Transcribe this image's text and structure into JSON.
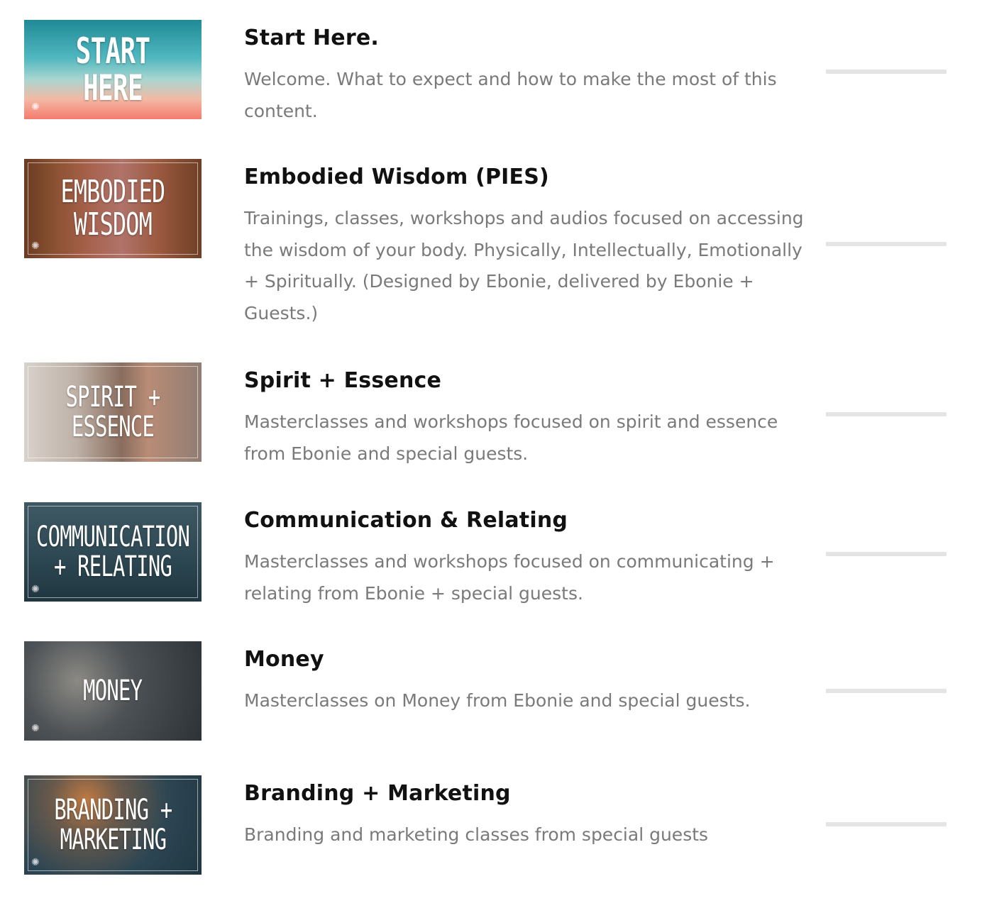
{
  "courses": [
    {
      "thumb_text": "START HERE",
      "thumb_bg": "linear-gradient(180deg,#1f8a96 0%,#4fb7bf 38%,#a9d6d0 60%,#f3b9a4 80%,#f47b6e 100%)",
      "title": "Start Here.",
      "description": "Welcome. What to expect and how to make the most of this content.",
      "progress": 0
    },
    {
      "thumb_text": "EMBODIED\nWISDOM",
      "thumb_bg": "linear-gradient(90deg,#6a3b22 0%,#8c5233 18%,#a5604a 35%,#b0736a 55%,#9c5a40 75%,#6e3f25 100%)",
      "title": "Embodied Wisdom (PIES)",
      "description": "Trainings, classes, workshops and audios focused on accessing the wisdom of your body. Physically, Intellectually, Emotionally + Spiritually. (Designed by Ebonie, delivered by Ebonie + Guests.)",
      "progress": 0
    },
    {
      "thumb_text": "SPIRIT + ESSENCE",
      "thumb_bg": "linear-gradient(90deg,#d9d2cc 0%,#bdb0a6 30%,#8a6d5e 55%,#b98c76 70%,#8f7d73 100%)",
      "title": "Spirit + Essence",
      "description": "Masterclasses and workshops focused on spirit and essence from Ebonie and special guests.",
      "progress": 0
    },
    {
      "thumb_text": "COMMUNICATION\n+ RELATING",
      "thumb_bg": "linear-gradient(180deg,#3e5964 0%,#2f4a55 50%,#1f3640 100%)",
      "title": "Communication & Relating",
      "description": "Masterclasses and workshops focused on communicating + relating from Ebonie + special guests.",
      "progress": 0
    },
    {
      "thumb_text": "MONEY",
      "thumb_bg": "radial-gradient(circle at 30% 40%,#8c8a84 0%,#4d5256 40%,#2c3236 100%)",
      "title": "Money",
      "description": "Masterclasses on Money from Ebonie and special guests.",
      "progress": 0
    },
    {
      "thumb_text": "BRANDING +\nMARKETING",
      "thumb_bg": "radial-gradient(circle at 35% 25%,#c07a43 0%,#6b5a4b 25%,#2d4653 60%,#1f3642 100%)",
      "title": "Branding + Marketing",
      "description": "Branding and marketing classes from special guests",
      "progress": 0
    }
  ]
}
